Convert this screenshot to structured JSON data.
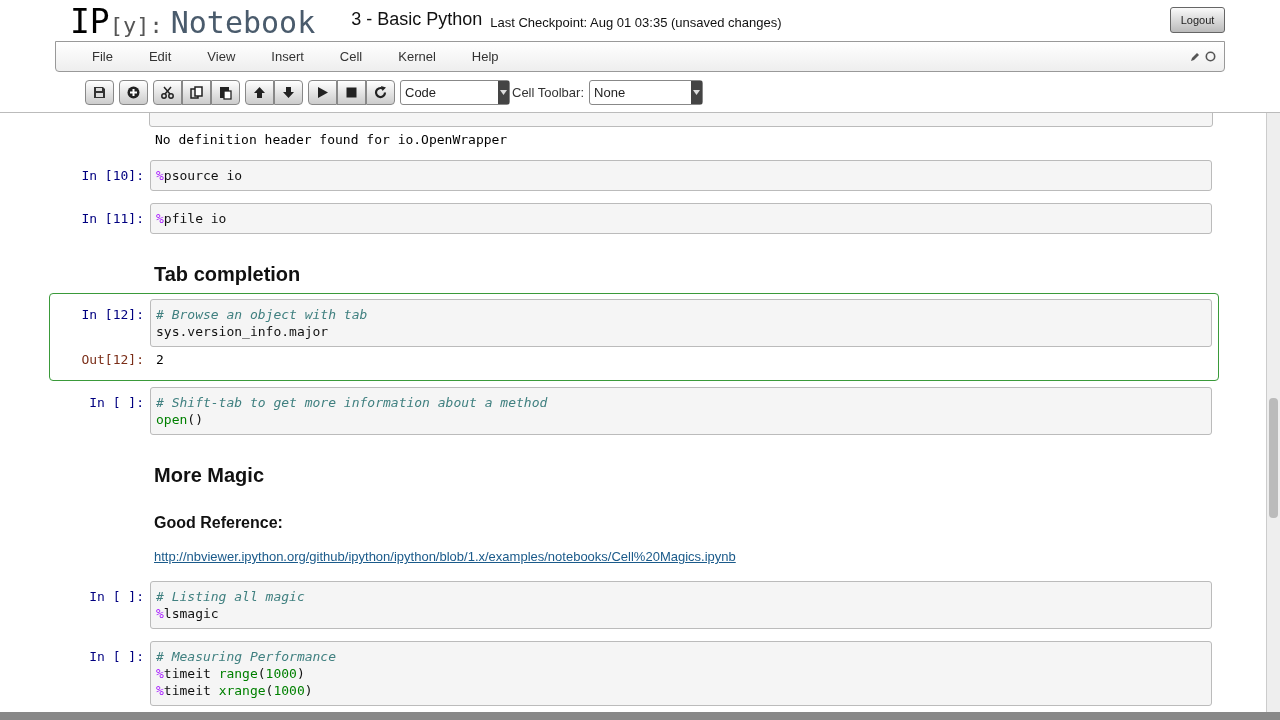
{
  "header": {
    "logo": [
      {
        "text": "IP",
        "kind": "strong"
      },
      {
        "text": "[y]:",
        "kind": "bracket"
      },
      {
        "text": "Notebook",
        "kind": "name"
      }
    ],
    "notebook_name": "3 - Basic Python",
    "checkpoint": "Last Checkpoint: Aug 01 03:35 (unsaved changes)",
    "logout": "Logout"
  },
  "menu": [
    "File",
    "Edit",
    "View",
    "Insert",
    "Cell",
    "Kernel",
    "Help"
  ],
  "toolbar": {
    "groups": [
      [
        {
          "kind": "save"
        }
      ],
      [
        {
          "kind": "add"
        }
      ],
      [
        {
          "kind": "cut"
        },
        {
          "kind": "copy"
        },
        {
          "kind": "paste"
        }
      ],
      [
        {
          "kind": "up"
        },
        {
          "kind": "down"
        }
      ],
      [
        {
          "kind": "run"
        },
        {
          "kind": "stop"
        },
        {
          "kind": "restart"
        }
      ]
    ],
    "cell_type": "Code",
    "cell_toolbar_label": "Cell Toolbar:",
    "cell_toolbar_value": "None"
  },
  "cells": [
    {
      "kind": "clipped",
      "output": "No definition header found for io.OpenWrapper"
    },
    {
      "kind": "code",
      "prompt": "In [10]:",
      "selected": false,
      "lines": [
        [
          {
            "text": "%",
            "kind": "magic"
          },
          {
            "text": "psource io",
            "kind": "plain"
          }
        ]
      ]
    },
    {
      "kind": "code",
      "prompt": "In [11]:",
      "selected": false,
      "lines": [
        [
          {
            "text": "%",
            "kind": "magic"
          },
          {
            "text": "pfile io",
            "kind": "plain"
          }
        ]
      ]
    },
    {
      "kind": "heading",
      "text": "Tab completion"
    },
    {
      "kind": "code",
      "prompt": "In [12]:",
      "selected": true,
      "lines": [
        [
          {
            "text": "# Browse an object with tab",
            "kind": "comment"
          }
        ],
        [
          {
            "text": "sys.version_info.major",
            "kind": "plain"
          }
        ]
      ],
      "out_prompt": "Out[12]:",
      "output": "2"
    },
    {
      "kind": "code",
      "prompt": "In [ ]:",
      "selected": false,
      "lines": [
        [
          {
            "text": "# Shift-tab to get more information about a method",
            "kind": "comment"
          }
        ],
        [
          {
            "text": "open",
            "kind": "builtin"
          },
          {
            "text": "()",
            "kind": "plain"
          }
        ]
      ]
    },
    {
      "kind": "heading",
      "text": "More Magic"
    },
    {
      "kind": "subheading",
      "text": "Good Reference:"
    },
    {
      "kind": "link",
      "text": "http://nbviewer.ipython.org/github/ipython/ipython/blob/1.x/examples/notebooks/Cell%20Magics.ipynb"
    },
    {
      "kind": "code",
      "prompt": "In [ ]:",
      "selected": false,
      "lines": [
        [
          {
            "text": "# Listing all magic",
            "kind": "comment"
          }
        ],
        [
          {
            "text": "%",
            "kind": "magic"
          },
          {
            "text": "lsmagic",
            "kind": "plain"
          }
        ]
      ]
    },
    {
      "kind": "code",
      "prompt": "In [ ]:",
      "selected": false,
      "lines": [
        [
          {
            "text": "# Measuring Performance",
            "kind": "comment"
          }
        ],
        [
          {
            "text": "%",
            "kind": "magic"
          },
          {
            "text": "timeit ",
            "kind": "plain"
          },
          {
            "text": "range",
            "kind": "builtin"
          },
          {
            "text": "(",
            "kind": "plain"
          },
          {
            "text": "1000",
            "kind": "number"
          },
          {
            "text": ")",
            "kind": "plain"
          }
        ],
        [
          {
            "text": "%",
            "kind": "magic"
          },
          {
            "text": "timeit ",
            "kind": "plain"
          },
          {
            "text": "xrange",
            "kind": "builtin"
          },
          {
            "text": "(",
            "kind": "plain"
          },
          {
            "text": "1000",
            "kind": "number"
          },
          {
            "text": ")",
            "kind": "plain"
          }
        ]
      ]
    }
  ]
}
